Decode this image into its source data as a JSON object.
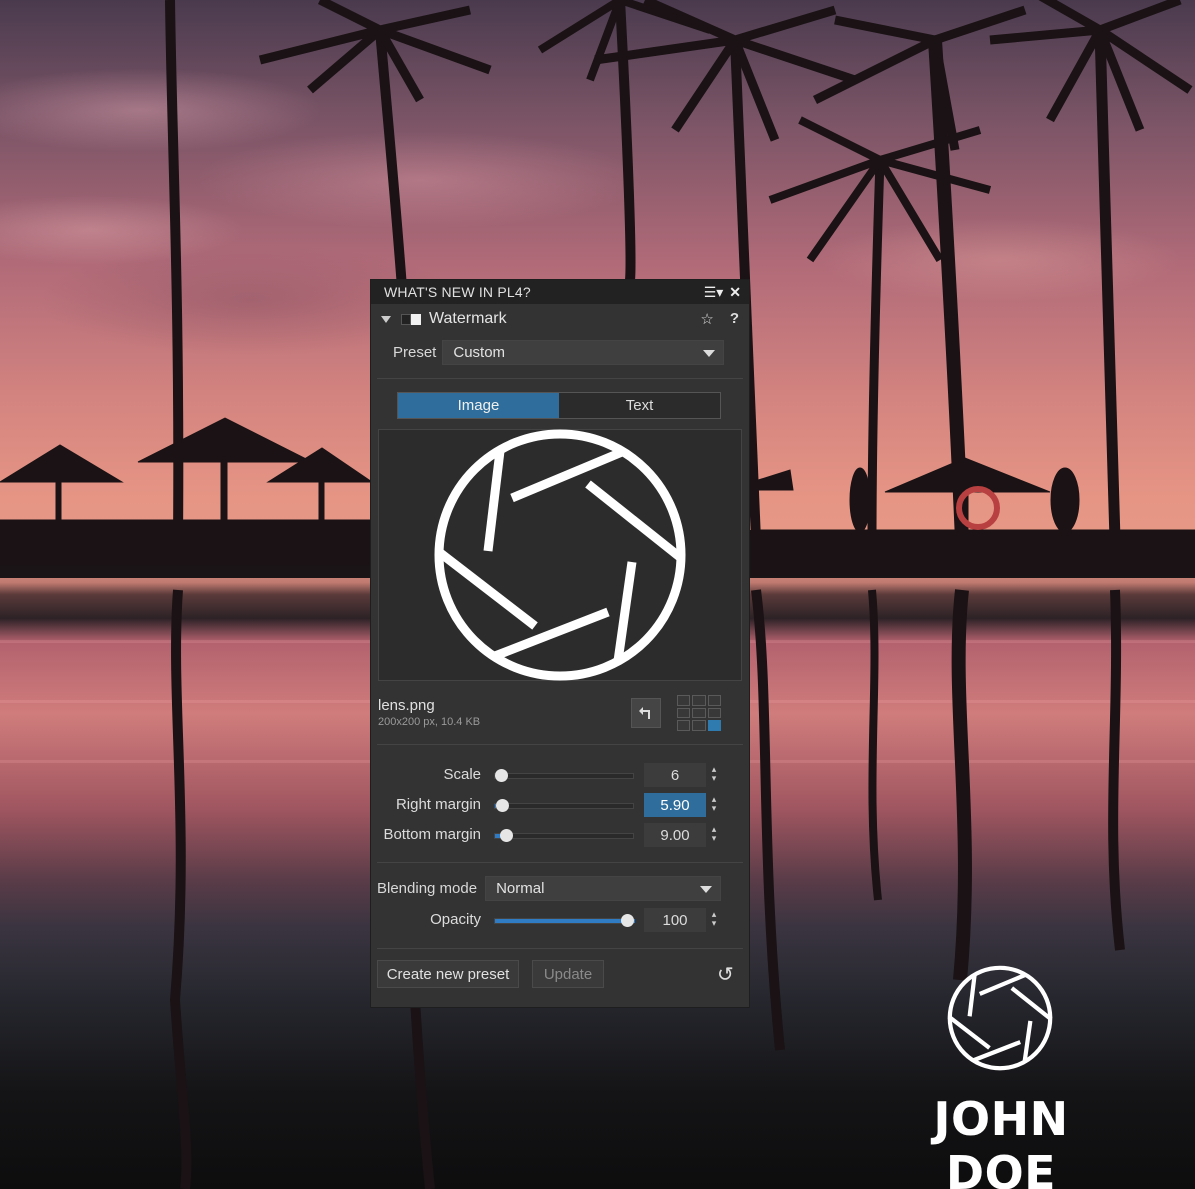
{
  "panel": {
    "title": "WHAT'S NEW IN PL4?",
    "title_icons": "☰▾ ✕",
    "section_name": "Watermark",
    "section_icons": [
      "star-icon",
      "help-icon"
    ],
    "star": "☆",
    "help": "?",
    "preset_label": "Preset",
    "preset_value": "Custom",
    "tabs": [
      {
        "label": "Image",
        "active": true
      },
      {
        "label": "Text",
        "active": false
      }
    ],
    "file_name": "lens.png",
    "file_meta": "200x200 px,  10.4 KB",
    "sliders": [
      {
        "label": "Scale",
        "value": "6",
        "fraction": 0.0,
        "active": false
      },
      {
        "label": "Right margin",
        "value": "5.90",
        "fraction": 0.01,
        "active": true
      },
      {
        "label": "Bottom margin",
        "value": "9.00",
        "fraction": 0.04,
        "active": false
      }
    ],
    "blending_label": "Blending mode",
    "blending_value": "Normal",
    "opacity_label": "Opacity",
    "opacity_value": "100",
    "opacity_fraction": 1.0,
    "create_preset_label": "Create new preset",
    "update_label": "Update",
    "accent_color": "#2f6e9c"
  },
  "watermark": {
    "brand_text": "JOHN DOE"
  }
}
